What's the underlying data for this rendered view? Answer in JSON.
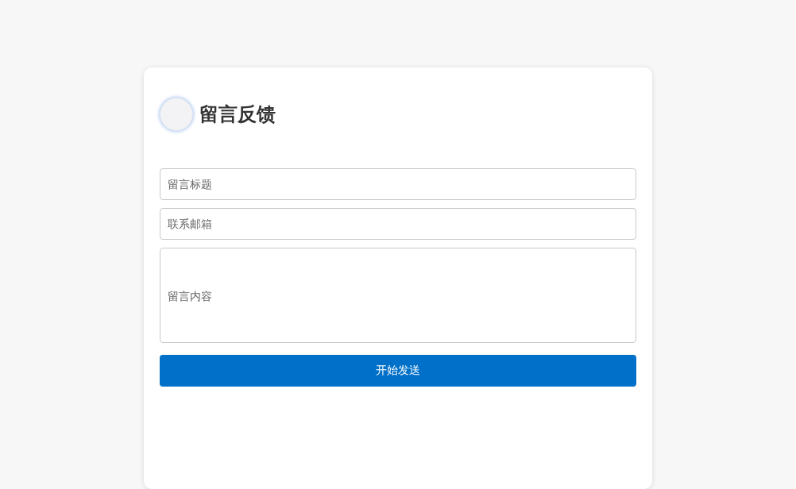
{
  "title": "留言反馈",
  "fields": [
    {
      "kind": "input",
      "placeholder": "留言标题"
    },
    {
      "kind": "input",
      "placeholder": "联系邮箱"
    },
    {
      "kind": "textarea",
      "placeholder": "留言内容"
    }
  ],
  "submit_button": "开始发送"
}
